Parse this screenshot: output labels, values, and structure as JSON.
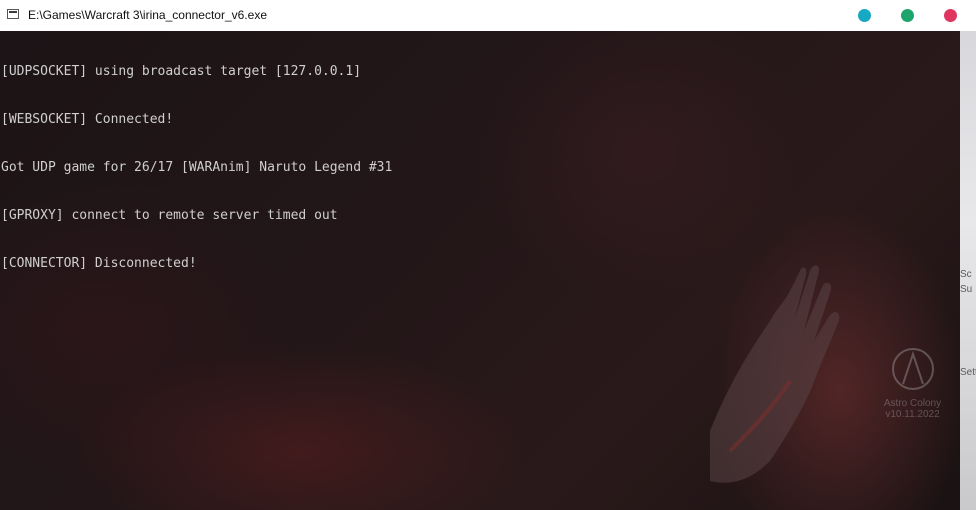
{
  "window": {
    "title": "E:\\Games\\Warcraft 3\\irina_connector_v6.exe",
    "buttons": {
      "cyan": "#17a8c4",
      "green": "#1fa56c",
      "red": "#e0355f"
    }
  },
  "console": {
    "lines": [
      "[UDPSOCKET] using broadcast target [127.0.0.1]",
      "[WEBSOCKET] Connected!",
      "Got UDP game for 26/17 [WARAnim] Naruto Legend #31",
      "[GPROXY] connect to remote server timed out",
      "[CONNECTOR] Disconnected!"
    ]
  },
  "background": {
    "watermark_name": "Astro Colony",
    "watermark_version": "v10.11.2022",
    "edge_labels": [
      "Sc",
      "Su",
      "Sett"
    ]
  }
}
